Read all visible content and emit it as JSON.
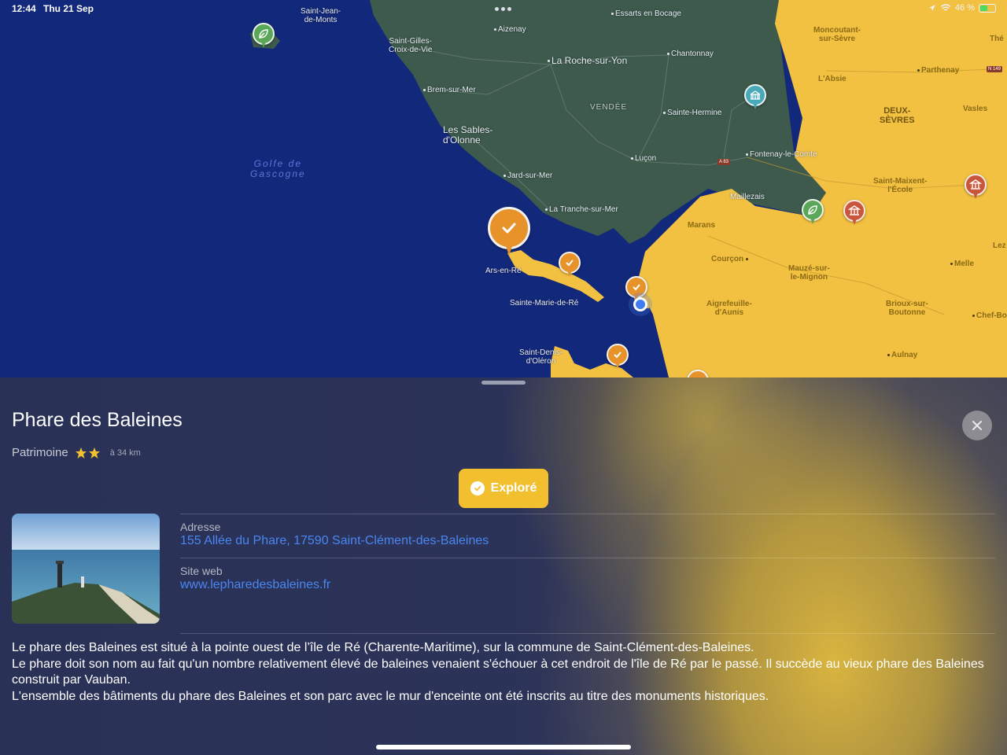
{
  "status_bar": {
    "time": "12:44",
    "date": "Thu 21 Sep",
    "battery": "46 %"
  },
  "map": {
    "colors": {
      "sea": "#12287a",
      "land": "#3d5a4c",
      "explored_region": "#f3c142",
      "accent_pin": "#e8922a"
    },
    "places": {
      "saint_jean_de_monts": "Saint-Jean-\nde-Monts",
      "essarts": "Essarts en Bocage",
      "aizenay": "Aizenay",
      "saint_gilles": "Saint-Gilles-\nCroix-de-Vie",
      "la_roche": "La Roche-sur-Yon",
      "chantonnay": "Chantonnay",
      "brem": "Brem-sur-Mer",
      "vendee": "VENDÉE",
      "sainte_hermine": "Sainte-Hermine",
      "les_sables": "Les Sables-\nd'Olonne",
      "golfe": "Golfe de\nGascogne",
      "lucon": "Luçon",
      "jard": "Jard-sur-Mer",
      "la_tranche": "La Tranche-sur-Mer",
      "ars": "Ars-en-Ré",
      "sainte_marie": "Sainte-Marie-de-Ré",
      "saint_denis": "Saint-Denis-\nd'Oléron",
      "moncoutant": "Moncoutant-\nsur-Sèvre",
      "parthenay": "Parthenay",
      "labsie": "L'Absie",
      "deux_sevres": "DEUX-\nSÈVRES",
      "vasles": "Vasles",
      "fontenay": "Fontenay-le-Comte",
      "saint_maixent": "Saint-Maixent-\nl'École",
      "maillezais": "Maillezais",
      "marans": "Marans",
      "courcon": "Courçon",
      "mauze": "Mauzé-sur-\nle-Mignon",
      "melle": "Melle",
      "aigrefeuille": "Aigrefeuille-\nd'Aunis",
      "brioux": "Brioux-sur-\nBoutonne",
      "chef_bo": "Chef-Bo",
      "aulnay": "Aulnay",
      "thenezay": "Thé",
      "lez": "Lez",
      "road_a83": "A 83",
      "road_n149": "N 149"
    }
  },
  "sheet": {
    "title": "Phare des Baleines",
    "category": "Patrimoine",
    "rating_stars": 2,
    "distance": "à 34 km",
    "explore_button": "Exploré",
    "address_label": "Adresse",
    "address_value": "155 Allée du Phare, 17590 Saint-Clément-des-Baleines",
    "website_label": "Site web",
    "website_value": "www.lepharedesbaleines.fr",
    "description": [
      "Le phare des Baleines est situé à la pointe ouest de l’île de Ré (Charente-Maritime), sur la commune de Saint-Clément-des-Baleines.",
      "Le phare doit son nom au fait qu'un nombre relativement élevé de baleines venaient s'échouer à cet endroit de l'île de Ré par le passé. Il succède au vieux phare des Baleines construit par Vauban.",
      "L'ensemble des bâtiments du phare des Baleines et son parc avec le mur d'enceinte ont été inscrits au titre des monuments historiques."
    ]
  }
}
